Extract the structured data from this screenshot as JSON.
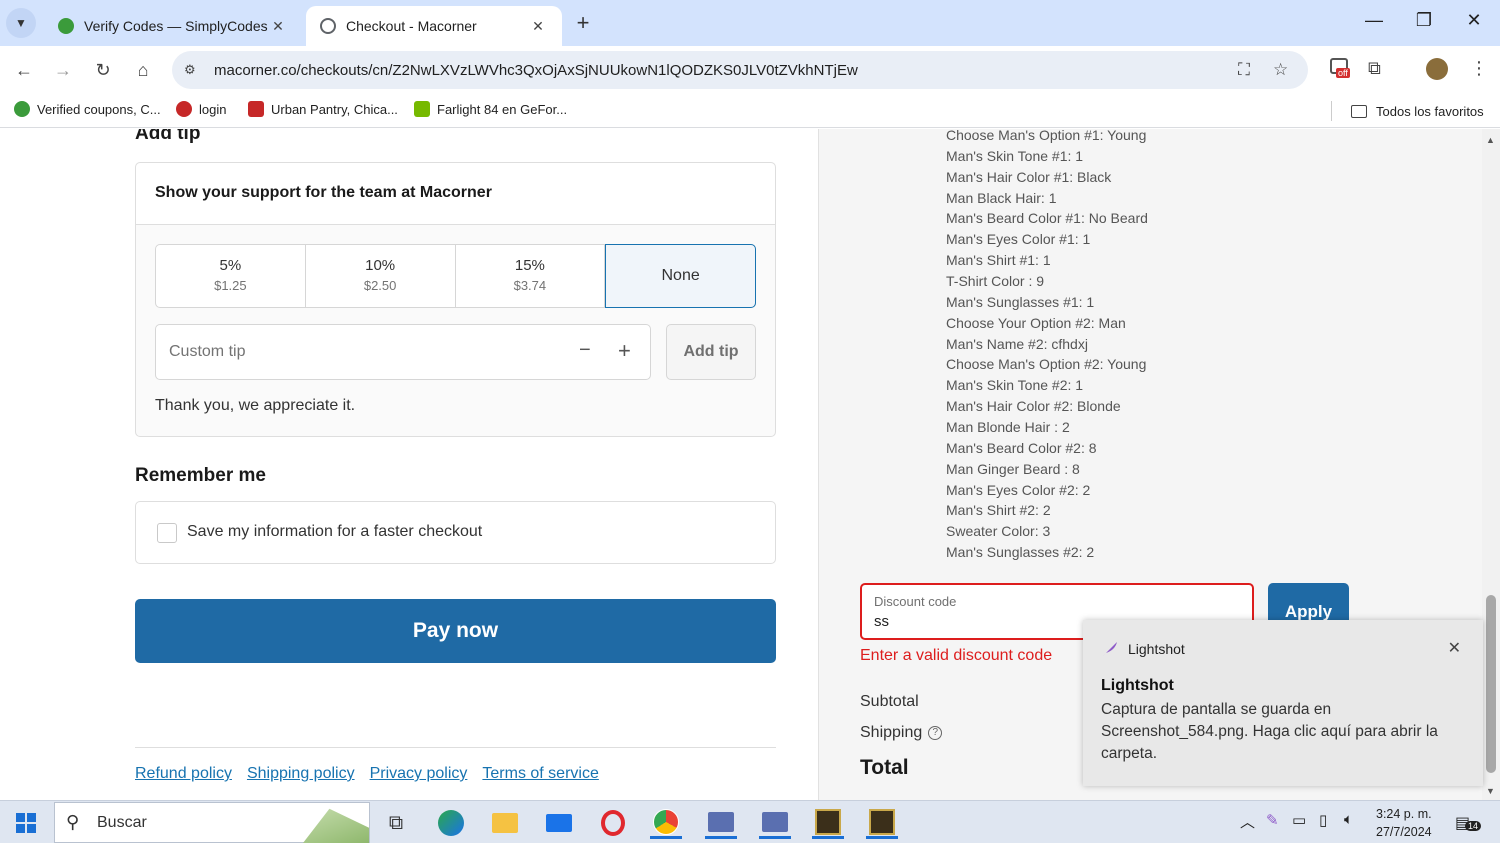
{
  "browser": {
    "tabs": [
      {
        "title": "Verify Codes — SimplyCodes",
        "active": false,
        "favicon_color": "#3b9b3b"
      },
      {
        "title": "Checkout - Macorner",
        "active": true,
        "favicon_color": "#5f6368"
      }
    ],
    "new_tab_label": "+",
    "url": "macorner.co/checkouts/cn/Z2NwLXVzLWVhc3QxOjAxSjNUUkowN1lQODZKS0JLV0tZVkhNTjEw",
    "off_badge": "off",
    "bookmarks": [
      {
        "label": "Verified coupons, C...",
        "color": "#3b9b3b"
      },
      {
        "label": "login",
        "color": "#c62828"
      },
      {
        "label": "Urban Pantry, Chica...",
        "color": "#c62828"
      },
      {
        "label": "Farlight 84 en GeFor...",
        "color": "#76b900"
      }
    ],
    "all_bookmarks_label": "Todos los favoritos"
  },
  "checkout": {
    "add_tip_heading": "Add tip",
    "tip_card_title": "Show your support for the team at Macorner",
    "tip_options": [
      {
        "pct": "5%",
        "amount": "$1.25"
      },
      {
        "pct": "10%",
        "amount": "$2.50"
      },
      {
        "pct": "15%",
        "amount": "$3.74"
      },
      {
        "pct": "None",
        "amount": ""
      }
    ],
    "custom_tip_placeholder": "Custom tip",
    "stepper_minus": "−",
    "stepper_plus": "+",
    "add_tip_button": "Add tip",
    "thanks_text": "Thank you, we appreciate it.",
    "remember_heading": "Remember me",
    "remember_checkbox_label": "Save my information for a faster checkout",
    "pay_button": "Pay now",
    "footer_links": [
      "Refund policy",
      "Shipping policy",
      "Privacy policy",
      "Terms of service"
    ]
  },
  "summary": {
    "item_properties": [
      "Choose Man's Option #1: Young",
      "Man's Skin Tone #1: 1",
      "Man's Hair Color #1: Black",
      "Man Black Hair: 1",
      "Man's Beard Color #1: No Beard",
      "Man's Eyes Color #1: 1",
      "Man's Shirt #1: 1",
      "T-Shirt Color : 9",
      "Man's Sunglasses #1: 1",
      "Choose Your Option #2: Man",
      "Man's Name #2: cfhdxj",
      "Choose Man's Option #2: Young",
      "Man's Skin Tone #2: 1",
      "Man's Hair Color #2: Blonde",
      "Man Blonde Hair : 2",
      "Man's Beard Color #2: 8",
      "Man Ginger Beard : 8",
      "Man's Eyes Color #2: 2",
      "Man's Shirt #2: 2",
      "Sweater Color: 3",
      "Man's Sunglasses #2: 2"
    ],
    "discount_label": "Discount code",
    "discount_value": "ss",
    "apply_button": "Apply",
    "discount_error": "Enter a valid discount code",
    "subtotal_label": "Subtotal",
    "shipping_label": "Shipping",
    "total_label": "Total"
  },
  "toast": {
    "app_name": "Lightshot",
    "title": "Lightshot",
    "body": "Captura de pantalla se guarda en Screenshot_584.png. Haga clic aquí para abrir la carpeta."
  },
  "taskbar": {
    "search_text": "Buscar",
    "time": "3:24 p. m.",
    "date": "27/7/2024",
    "notification_count": "14"
  }
}
